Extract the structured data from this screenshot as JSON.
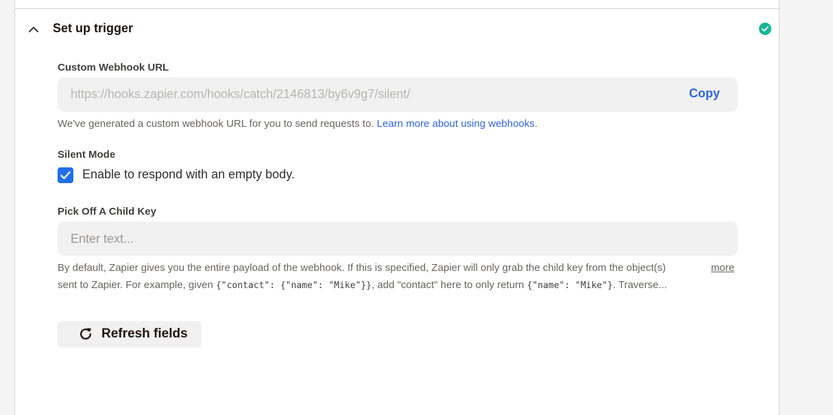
{
  "section": {
    "title": "Set up trigger",
    "status_icon": "check-circle-icon",
    "status_color": "#13b796"
  },
  "webhook": {
    "label": "Custom Webhook URL",
    "url": "https://hooks.zapier.com/hooks/catch/2146813/by6v9g7/silent/",
    "copy_label": "Copy",
    "help_text": "We've generated a custom webhook URL for you to send requests to. ",
    "help_link": "Learn more about using webhooks",
    "help_suffix": "."
  },
  "silent_mode": {
    "label": "Silent Mode",
    "checkbox_label": "Enable to respond with an empty body.",
    "checked": true
  },
  "child_key": {
    "label": "Pick Off A Child Key",
    "placeholder": "Enter text...",
    "value": "",
    "desc_line1": "By default, Zapier gives you the entire payload of the webhook. If this is specified, Zapier will only grab the child key from the object(s)",
    "desc_line2_a": "sent to Zapier. For example, given ",
    "desc_line2_code1": "{\"contact\": {\"name\": \"Mike\"}}",
    "desc_line2_b": ", add \"contact\" here to only return ",
    "desc_line2_code2": "{\"name\": \"Mike\"}",
    "desc_line2_c": ". Traverse...",
    "more_label": "more"
  },
  "refresh": {
    "label": "Refresh fields",
    "icon": "refresh-icon"
  },
  "colors": {
    "accent": "#3064e3",
    "checkbox": "#1f6ee8",
    "success": "#13b796"
  }
}
